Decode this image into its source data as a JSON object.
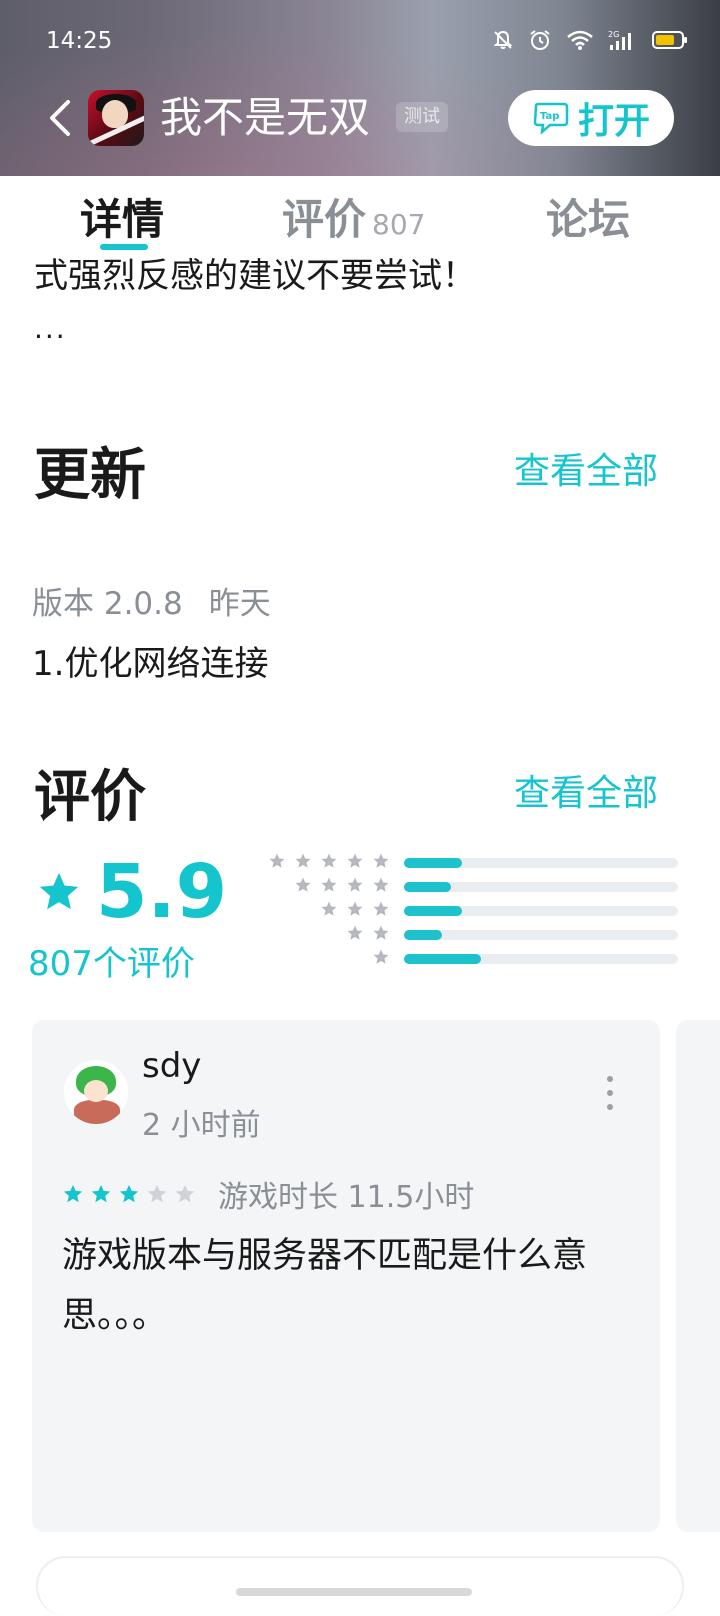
{
  "status_bar": {
    "time": "14:25"
  },
  "header": {
    "app_title": "我不是无双",
    "test_badge": "测试",
    "open_button": "打开",
    "open_logo_text": "Tap"
  },
  "tabs": {
    "details": "详情",
    "reviews": "评价",
    "reviews_count": "807",
    "forum": "论坛"
  },
  "description": {
    "tail_text": "式强烈反感的建议不要尝试！",
    "ellipsis": "..."
  },
  "update": {
    "title": "更新",
    "see_all": "查看全部",
    "version": "版本 2.0.8",
    "date": "昨天",
    "note": "1.优化网络连接"
  },
  "ratings": {
    "title": "评价",
    "see_all": "查看全部",
    "score": "5.9",
    "count": "807个评价",
    "distribution": [
      {
        "stars": 5,
        "fraction": 0.21
      },
      {
        "stars": 4,
        "fraction": 0.17
      },
      {
        "stars": 3,
        "fraction": 0.21
      },
      {
        "stars": 2,
        "fraction": 0.14
      },
      {
        "stars": 1,
        "fraction": 0.28
      }
    ]
  },
  "review": {
    "user": "sdy",
    "time": "2 小时前",
    "stars": 3,
    "max_stars": 5,
    "playtime": "游戏时长 11.5小时",
    "text": "游戏版本与服务器不匹配是什么意思。。。"
  },
  "colors": {
    "accent": "#15c5ce",
    "muted_text": "#8a8f96",
    "card_bg": "#f3f5f7"
  }
}
